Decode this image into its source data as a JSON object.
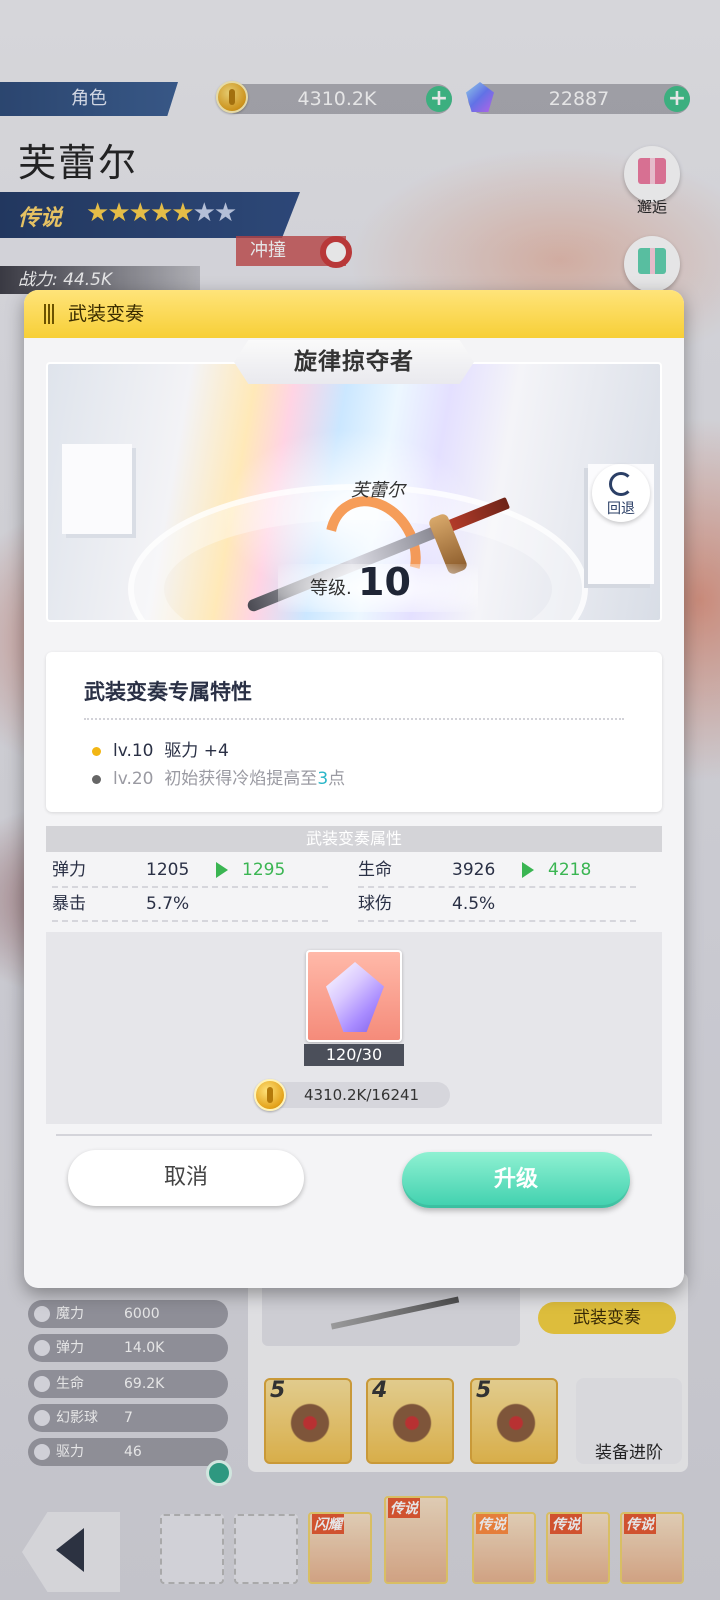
{
  "topbar": {
    "tab_label": "角色",
    "gold": "4310.2K",
    "gems": "22887"
  },
  "character": {
    "name": "芙蕾尔",
    "rarity": "传说",
    "stars_filled": 5,
    "stars_total": 7,
    "class": "冲撞",
    "power": "战力: 44.5K"
  },
  "side": {
    "gift_label": "邂逅"
  },
  "stats_panel": [
    {
      "label": "魔力",
      "value": "6000"
    },
    {
      "label": "弹力",
      "value": "14.0K"
    },
    {
      "label": "生命",
      "value": "69.2K"
    },
    {
      "label": "幻影球",
      "value": "7"
    },
    {
      "label": "驱力",
      "value": "46"
    }
  ],
  "equipment": {
    "weapon_tag": "武装变奏",
    "levels": [
      "5",
      "4",
      "5"
    ],
    "advance_label": "装备进阶"
  },
  "bottom_nav": {
    "portraits": [
      "闪耀",
      "传说",
      "传说",
      "传说",
      "传说"
    ]
  },
  "modal": {
    "title": "武装变奏",
    "weapon_name": "旋律掠夺者",
    "owner": "芙蕾尔",
    "reset_label": "回退",
    "level_label": "等级.",
    "level": "10",
    "traits": {
      "title": "武装变奏专属特性",
      "items": [
        {
          "level": "lv.10",
          "text": "驱力 +4",
          "active": true
        },
        {
          "level": "lv.20",
          "text_before": "初始获得冷焰提高至",
          "highlight": "3",
          "text_after": "点",
          "active": false
        }
      ]
    },
    "attributes": {
      "header": "武装变奏属性",
      "rows": [
        {
          "label": "弹力",
          "value": "1205",
          "next": "1295"
        },
        {
          "label": "生命",
          "value": "3926",
          "next": "4218"
        },
        {
          "label": "暴击",
          "value": "5.7%"
        },
        {
          "label": "球伤",
          "value": "4.5%"
        }
      ]
    },
    "cost": {
      "material_count": "120/30",
      "gold": "4310.2K/16241"
    },
    "cancel_label": "取消",
    "upgrade_label": "升级"
  }
}
